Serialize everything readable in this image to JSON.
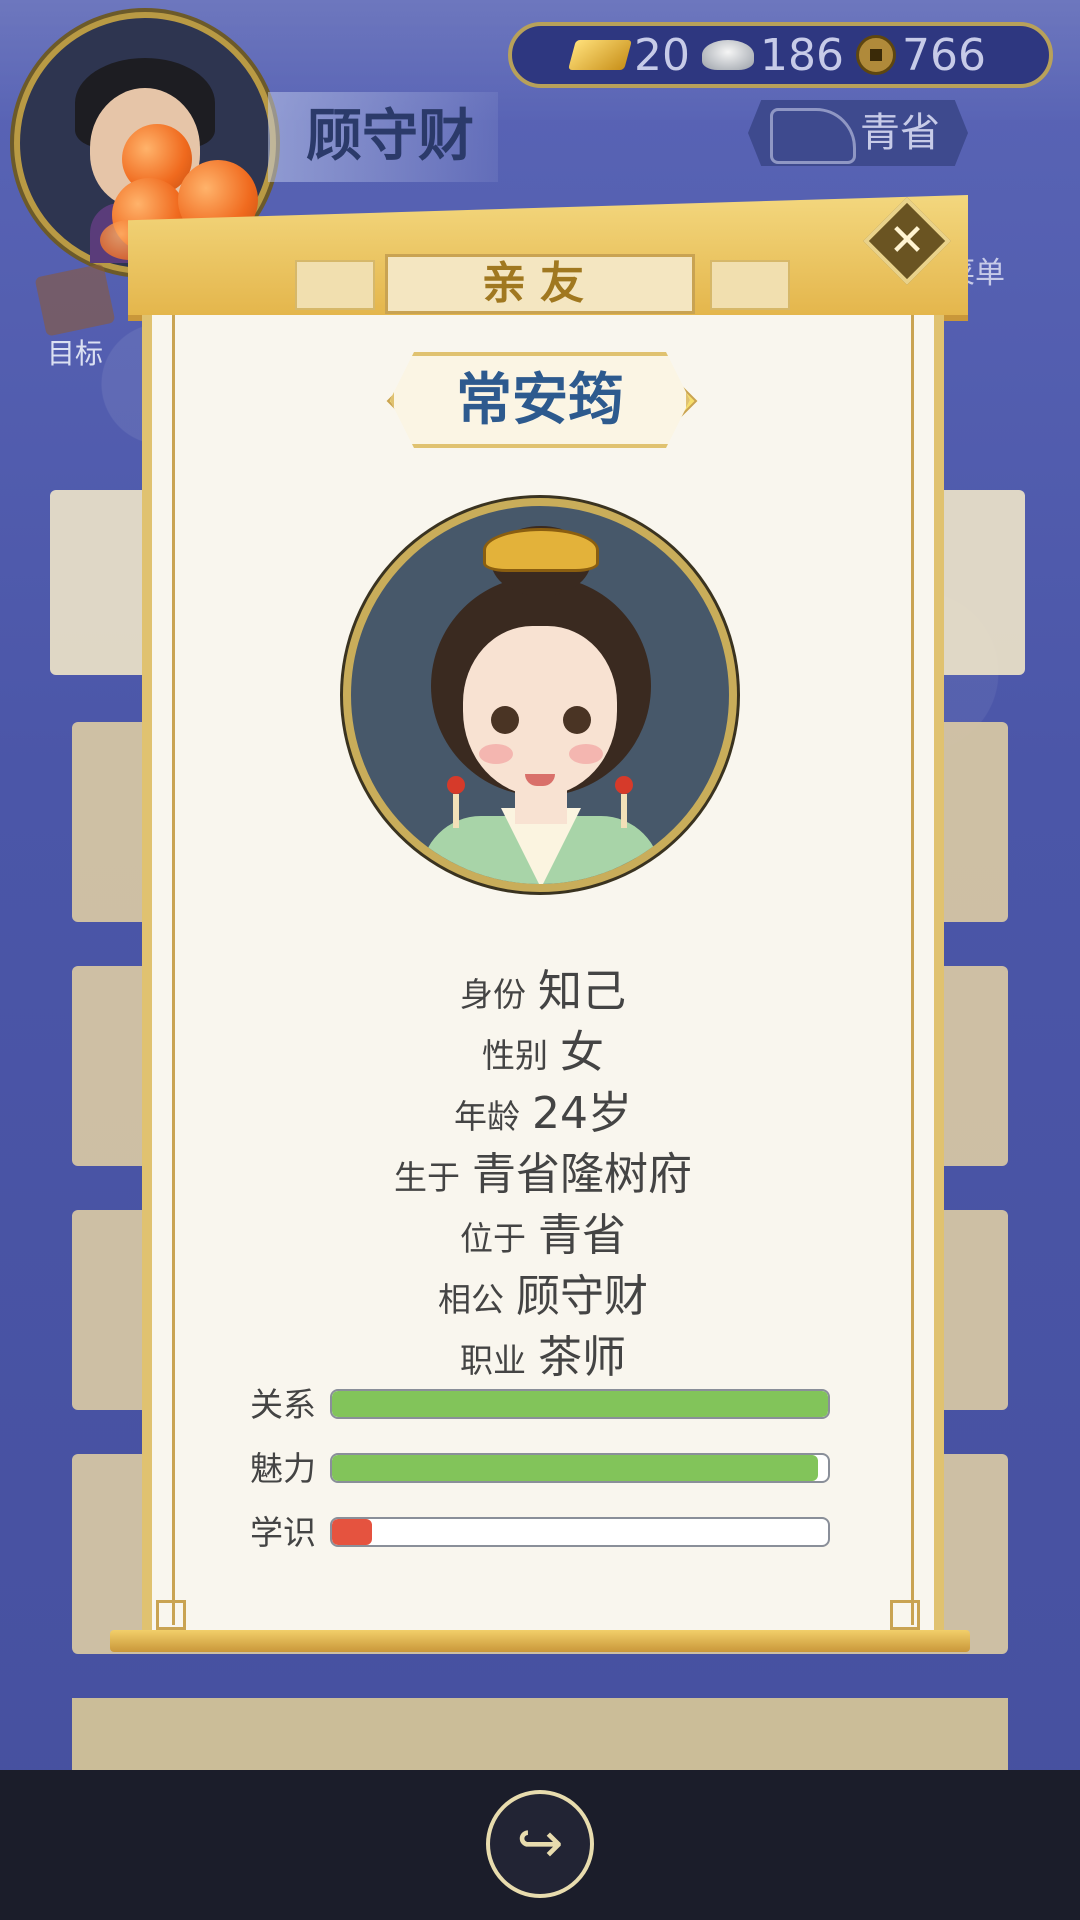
{
  "top_bar": {
    "player_name": "顾守财",
    "gold": "20",
    "silver": "186",
    "coins": "766",
    "province": "青省",
    "target_label": "目标",
    "menu_label": "菜单"
  },
  "dialog": {
    "title": "亲友",
    "character_name": "常安筠",
    "info": [
      {
        "key": "身份",
        "value": "知己"
      },
      {
        "key": "性别",
        "value": "女"
      },
      {
        "key": "年龄",
        "value": "24岁"
      },
      {
        "key": "生于",
        "value": "青省隆树府"
      },
      {
        "key": "位于",
        "value": "青省"
      },
      {
        "key": "相公",
        "value": "顾守财"
      },
      {
        "key": "职业",
        "value": "茶师"
      }
    ],
    "stats": [
      {
        "label": "关系",
        "fraction": 1.0,
        "color": "#82c45a"
      },
      {
        "label": "魅力",
        "fraction": 0.98,
        "color": "#82c45a"
      },
      {
        "label": "学识",
        "fraction": 0.08,
        "color": "#e5533f"
      }
    ]
  },
  "bottom": {
    "share_icon": "share-icon"
  }
}
